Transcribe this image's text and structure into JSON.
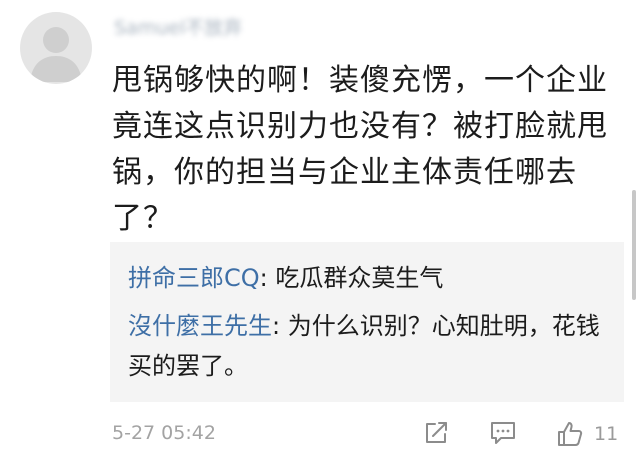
{
  "comment": {
    "author": "Samuel不放弃",
    "body": "甩锅够快的啊！装傻充愣，一个企业竟连这点识别力也没有？被打脸就甩锅，你的担当与企业主体责任哪去了？",
    "timestamp": "5-27 05:42",
    "like_count": "11"
  },
  "replies": [
    {
      "name": "拼命三郎CQ",
      "separator": ": ",
      "text": "吃瓜群众莫生气"
    },
    {
      "name": "沒什麼王先生",
      "separator": ": ",
      "text": "为什么识别？心知肚明，花钱买的罢了。"
    }
  ],
  "icons": {
    "avatar": "default-user-avatar",
    "share": "share-icon",
    "reply": "comment-icon",
    "like": "thumbs-up-icon"
  },
  "colors": {
    "reply_name": "#3e6fa6",
    "reply_background": "#f4f4f4",
    "meta_text": "#a3a3a3",
    "avatar_background": "#e5e5e5"
  }
}
